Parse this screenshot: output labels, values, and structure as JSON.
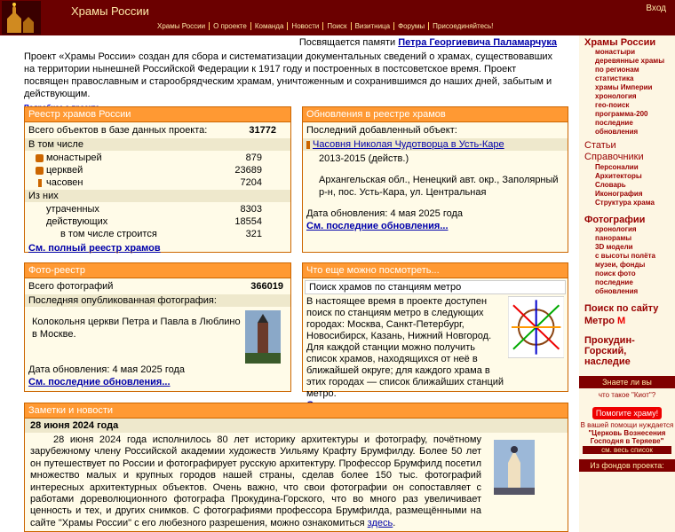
{
  "header": {
    "title": "Храмы России",
    "login": "Вход",
    "nav": [
      "Храмы России",
      "О проекте",
      "Команда",
      "Новости",
      "Поиск",
      "Визитница",
      "Форумы",
      "Присоединяйтесь!"
    ]
  },
  "intro": {
    "dedication_prefix": "Посвящается памяти",
    "dedication_name": "Петра Георгиевича Паламарчука",
    "text": "Проект «Храмы России» создан для сбора и систематизации документальных сведений о храмах, существовавших на территории нынешней Российской Федерации к 1917 году и построенных в постсоветское время. Проект посвящен православным и старообрядческим храмам, уничтоженным и сохранившимся до наших дней, забытым и действующим.",
    "more": "Подробнее о проекте"
  },
  "registry": {
    "title": "Реестр храмов России",
    "total_label": "Всего объектов в базе данных проекта:",
    "total_value": "31772",
    "incl": "В том числе",
    "rows": [
      {
        "label": "монастырей",
        "value": "879"
      },
      {
        "label": "церквей",
        "value": "23689"
      },
      {
        "label": "часовен",
        "value": "7204"
      }
    ],
    "of": "Из них",
    "rows2": [
      {
        "label": "утраченных",
        "value": "8303"
      },
      {
        "label": "действующих",
        "value": "18554"
      },
      {
        "label": "в том числе строится",
        "value": "321"
      }
    ],
    "link": "См. полный реестр храмов"
  },
  "updates": {
    "title": "Обновления в реестре храмов",
    "last_label": "Последний добавленный объект:",
    "object": "Часовня Николая Чудотворца в Усть-Каре",
    "years": "2013-2015 (действ.)",
    "address": "Архангельская обл., Ненецкий авт. окр., Заполярный р-н, пос. Усть-Кара, ул. Центральная",
    "date": "Дата обновления: 4 мая 2025 года",
    "link": "См. последние обновления..."
  },
  "photo": {
    "title": "Фото-реестр",
    "total_label": "Всего фотографий",
    "total_value": "366019",
    "last_label": "Последняя опубликованная фотография:",
    "caption": "Колокольня церкви Петра и Павла в Люблино в Москве.",
    "date": "Дата обновления: 4 мая 2025 года",
    "link": "См. последние обновления..."
  },
  "more_box": {
    "title": "Что еще можно посмотреть...",
    "sub": "Поиск храмов по станциям метро",
    "text": "В настоящее время в проекте доступен поиск по станциям метро в следующих городах: Москва, Санкт-Петербург, Новосибирск, Казань, Нижний Новгород. Для каждой станции можно получить список храмов, находящихся от неё в ближайшей округе; для каждого храма в этих городах — список ближайших станций метро.",
    "link": "Список метрополитенов"
  },
  "news": {
    "title": "Заметки и новости",
    "date": "28 июня 2024 года",
    "text": "28 июня 2024 года исполнилось 80 лет историку архитектуры и фотографу, почётному зарубежному члену Российской академии художеств Уильяму Крафту Брумфилду. Более 50 лет он путешествует по России и фотографирует русскую архитектуру. Профессор Брумфилд посетил множество малых и крупных городов нашей страны, сделав более 150 тыс. фотографий интересных архитектурных объектов. Очень важно, что свои фотографии он сопоставляет с работами дореволюционного фотографа Прокудина-Горского, что во много раз увеличивает ценность и тех, и других снимков. С фотографиями профессора Брумфилда, размещёнными на сайте \"Храмы России\" с его любезного разрешения, можно ознакомиться",
    "here": "здесь"
  },
  "sidebar": {
    "title1": "Храмы России",
    "items1": [
      "монастыри",
      "деревянные храмы",
      "по регионам",
      "статистика",
      "храмы Империи",
      "хронология",
      "гео-поиск",
      "программа-200",
      "последние обновления"
    ],
    "title2": "Статьи",
    "title3": "Справочники",
    "items3": [
      "Персоналии",
      "Архитекторы",
      "Словарь",
      "Иконография",
      "Структура храма"
    ],
    "title4": "Фотографии",
    "items4": [
      "хронология",
      "панорамы",
      "3D модели",
      "с высоты полёта",
      "музеи, фонды",
      "поиск фото",
      "последние обновления"
    ],
    "search_metro": "Поиск по сайту",
    "metro": "Метро",
    "metro_m": "М",
    "prokudin": "Прокудин-Горский, наследие",
    "know": "Знаете ли вы",
    "know_q": "что такое \"Киот\"?",
    "help": "Помогите храму!",
    "help_text": "В вашей помощи нуждается",
    "help_church": "\"Церковь Вознесения Господня в Теряеве\"",
    "help_list": "см. весь список",
    "funds": "Из фондов проекта:"
  },
  "colors": {
    "header": "#6b0000",
    "box_title": "#ff9933",
    "link": "#0000aa"
  }
}
